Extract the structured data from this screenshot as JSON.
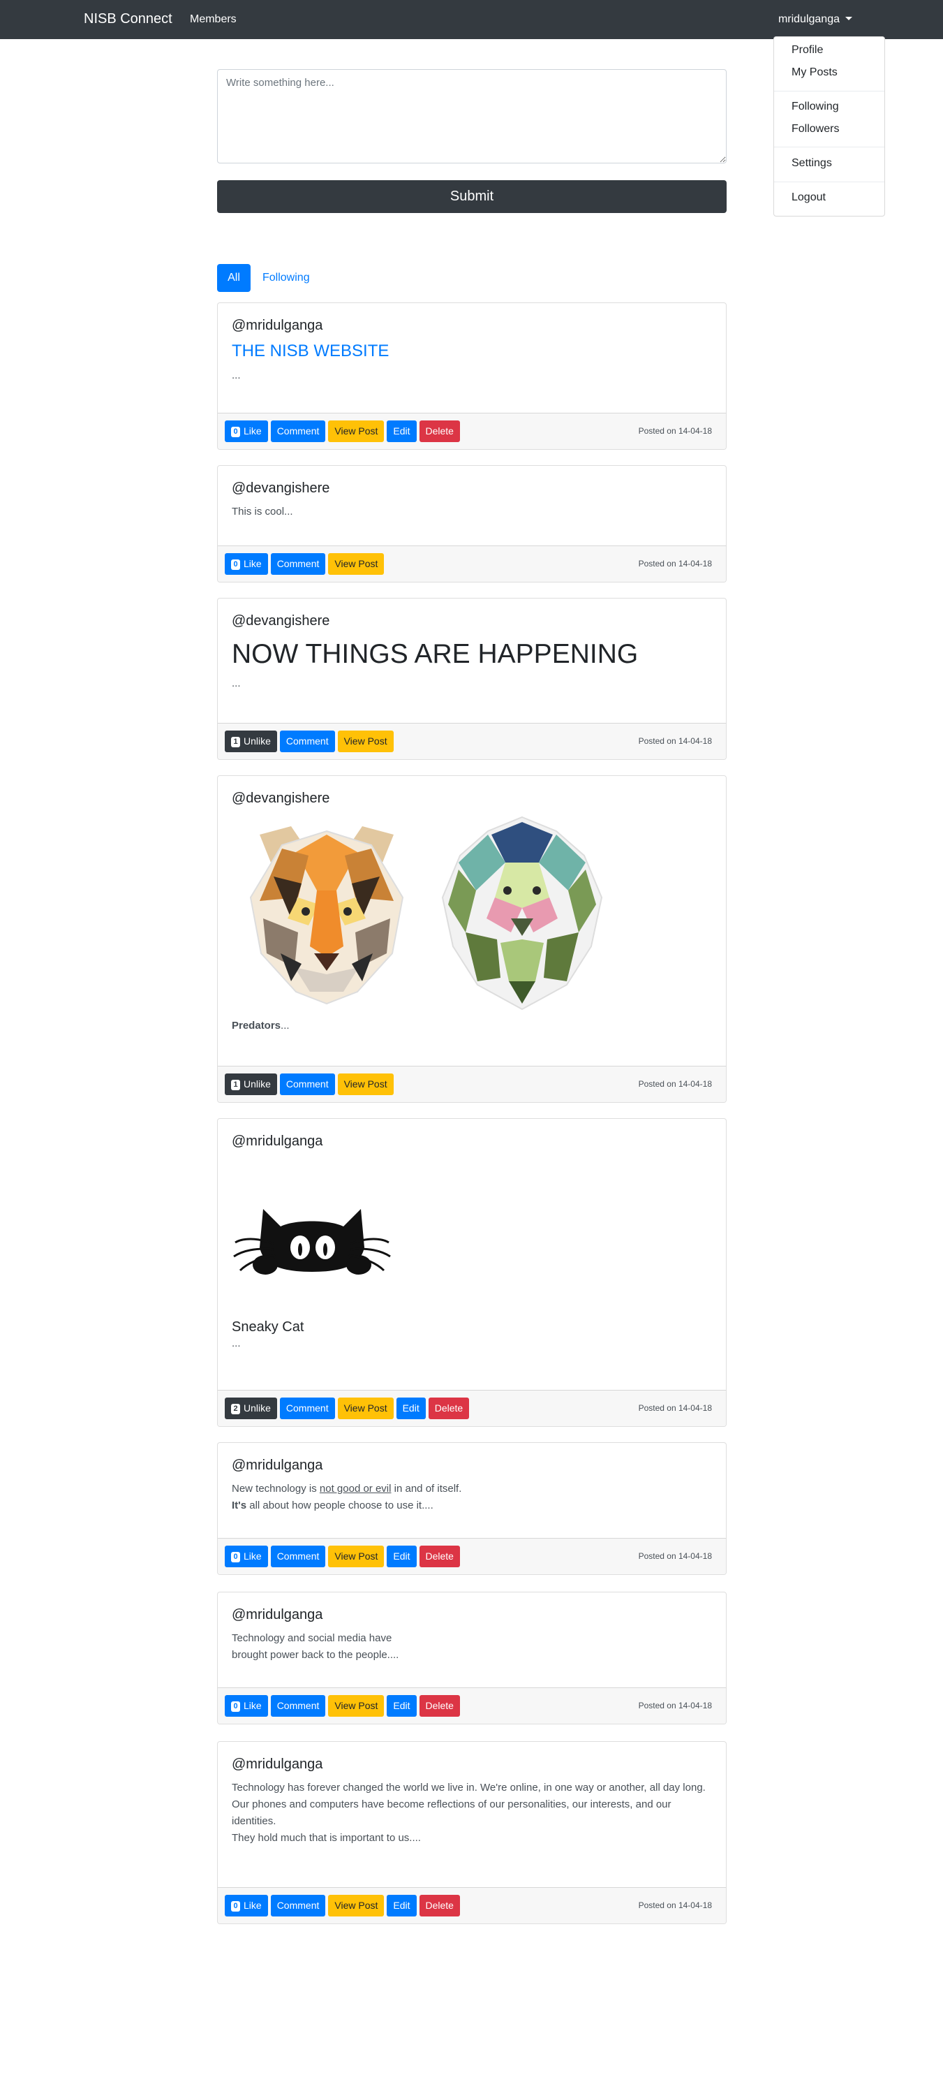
{
  "nav": {
    "brand": "NISB Connect",
    "members": "Members",
    "user": "mridulganga"
  },
  "dropdown": {
    "profile": "Profile",
    "my_posts": "My Posts",
    "following": "Following",
    "followers": "Followers",
    "settings": "Settings",
    "logout": "Logout"
  },
  "composer": {
    "placeholder": "Write something here...",
    "submit": "Submit"
  },
  "tabs": {
    "all": "All",
    "following": "Following"
  },
  "labels": {
    "like": "Like",
    "unlike": "Unlike",
    "comment": "Comment",
    "view_post": "View Post",
    "edit": "Edit",
    "delete": "Delete",
    "ellipsis": "..."
  },
  "colors": {
    "navbar": "#343a40",
    "primary": "#007bff",
    "warning": "#ffc107",
    "danger": "#dc3545",
    "dark": "#343a40"
  },
  "posts": [
    {
      "author": "@mridulganga",
      "title": "THE NISB WEBSITE",
      "likes": "0",
      "posted": "Posted on 14-04-18"
    },
    {
      "author": "@devangishere",
      "text": "This is cool...",
      "likes": "0",
      "posted": "Posted on 14-04-18"
    },
    {
      "author": "@devangishere",
      "title": "NOW THINGS ARE HAPPENING",
      "likes": "1",
      "posted": "Posted on 14-04-18"
    },
    {
      "author": "@devangishere",
      "bold": "Predators",
      "rest": "...",
      "likes": "1",
      "posted": "Posted on 14-04-18",
      "images": [
        "tiger-illustration",
        "lion-illustration"
      ]
    },
    {
      "author": "@mridulganga",
      "title": "Sneaky Cat",
      "likes": "2",
      "posted": "Posted on 14-04-18",
      "images": [
        "cat-illustration"
      ]
    },
    {
      "author": "@mridulganga",
      "line1_a": "New technology is ",
      "line1_u": "not good or evil",
      "line1_b": " in and of itself.",
      "line2_bold": "It's",
      "line2_rest": " all about how people choose to use it....",
      "likes": "0",
      "posted": "Posted on 14-04-18"
    },
    {
      "author": "@mridulganga",
      "line1": "Technology and social media have",
      "line2": "brought power back to the people....",
      "likes": "0",
      "posted": "Posted on 14-04-18"
    },
    {
      "author": "@mridulganga",
      "line1": "Technology has forever changed the world we live in. We're online, in one way or another, all day long.",
      "line2": "Our phones and computers have become reflections of our personalities, our interests, and our identities.",
      "line3": "They hold much that is important to us....",
      "likes": "0",
      "posted": "Posted on 14-04-18"
    }
  ]
}
